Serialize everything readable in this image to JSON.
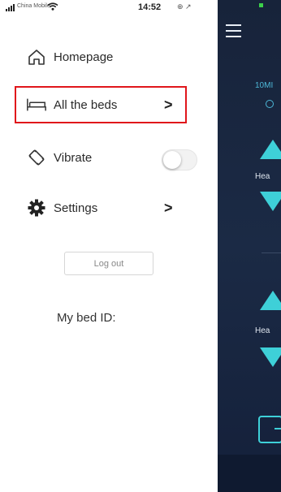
{
  "status_bar": {
    "carrier": "China Mobile",
    "time": "14:52",
    "system_icons": "⊕ ↗"
  },
  "drawer": {
    "items": [
      {
        "label": "Homepage",
        "icon": "home-icon"
      },
      {
        "label": "All the beds",
        "icon": "bed-icon",
        "chevron": ">"
      },
      {
        "label": "Vibrate",
        "icon": "vibrate-icon",
        "toggle_on": false
      },
      {
        "label": "Settings",
        "icon": "gear-icon",
        "chevron": ">"
      }
    ],
    "logout_label": "Log out",
    "bed_id_label": "My bed ID:"
  },
  "panel": {
    "mode_label": "10MI",
    "head_label_1": "Hea",
    "head_label_2": "Hea"
  },
  "colors": {
    "highlight": "#e0161b",
    "panel_bg": "#1b2a45",
    "accent": "#3ed0d8"
  }
}
